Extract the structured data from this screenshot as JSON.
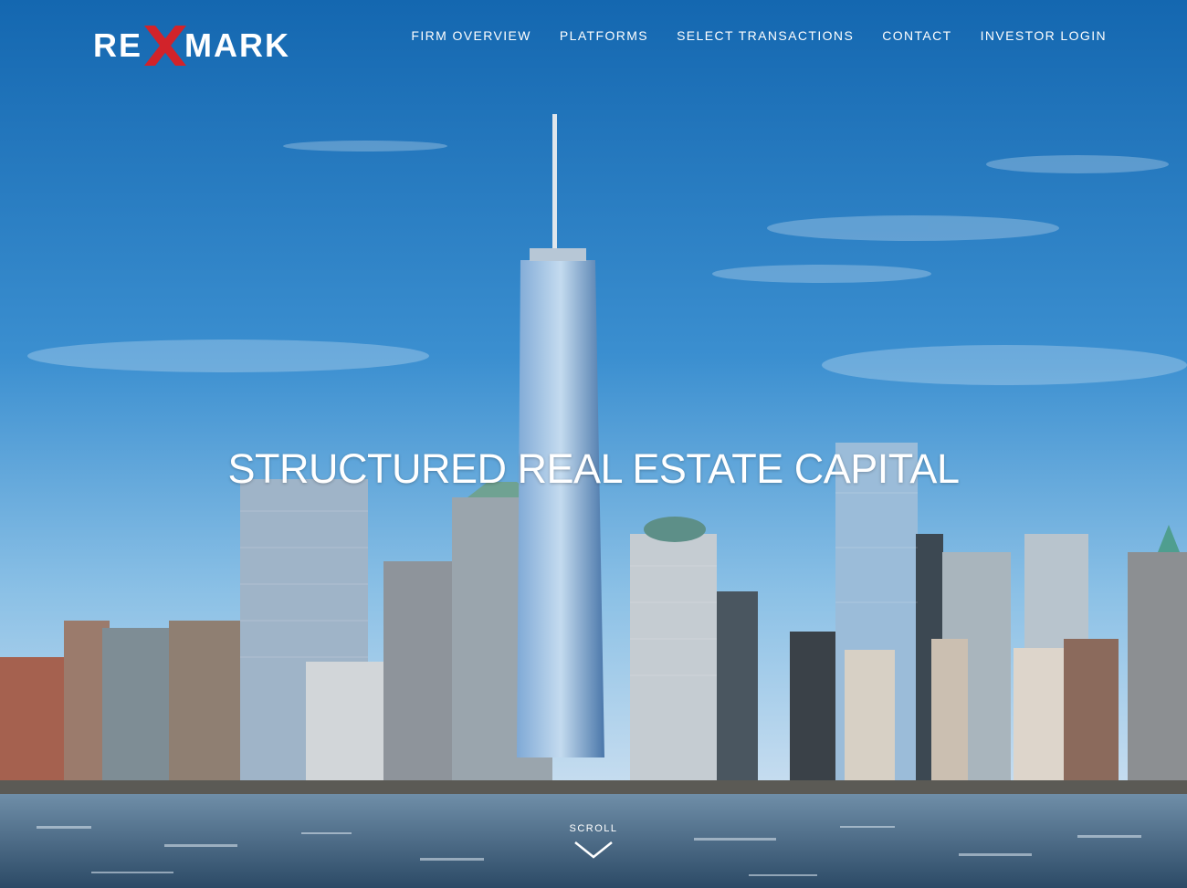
{
  "brand": {
    "logo_part1": "RE",
    "logo_x": "X",
    "logo_part2": "MARK",
    "accent_color": "#d2232a"
  },
  "nav": {
    "items": [
      {
        "label": "FIRM OVERVIEW"
      },
      {
        "label": "PLATFORMS"
      },
      {
        "label": "SELECT TRANSACTIONS"
      },
      {
        "label": "CONTACT"
      },
      {
        "label": "INVESTOR LOGIN"
      }
    ]
  },
  "hero": {
    "headline": "STRUCTURED REAL ESTATE CAPITAL",
    "scroll_label": "SCROLL",
    "scroll_icon": "chevron-down-icon"
  }
}
